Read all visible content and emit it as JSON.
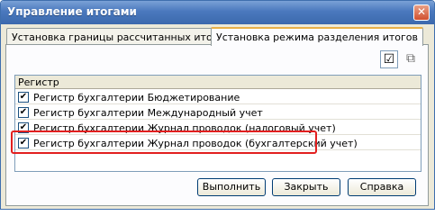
{
  "window": {
    "title": "Управление итогами",
    "close_glyph": "✕"
  },
  "tabs": [
    {
      "label": "Установка границы рассчитанных итогов",
      "active": false
    },
    {
      "label": "Установка режима разделения итогов",
      "active": true
    }
  ],
  "toolbar": {
    "check_all_icon": "checkbox-icon",
    "copy_icon": "copy-icon",
    "check_glyph": "☑",
    "copy_glyph": "⧉"
  },
  "grid": {
    "header": "Регистр",
    "rows": [
      {
        "label": "Регистр бухгалтерии Бюджетирование",
        "checked": true
      },
      {
        "label": "Регистр бухгалтерии Международный учет",
        "checked": true
      },
      {
        "label": "Регистр бухгалтерии Журнал проводок (налоговый учет)",
        "checked": true
      },
      {
        "label": "Регистр бухгалтерии Журнал проводок (бухгалтерский учет)",
        "checked": true
      }
    ],
    "check_mark": "✔"
  },
  "buttons": {
    "execute": "Выполнить",
    "close": "Закрыть",
    "help": "Справка"
  },
  "colors": {
    "title_bar": "#4a78bd",
    "highlight": "#e21f1f",
    "active_tab_accent": "#e8b048"
  }
}
